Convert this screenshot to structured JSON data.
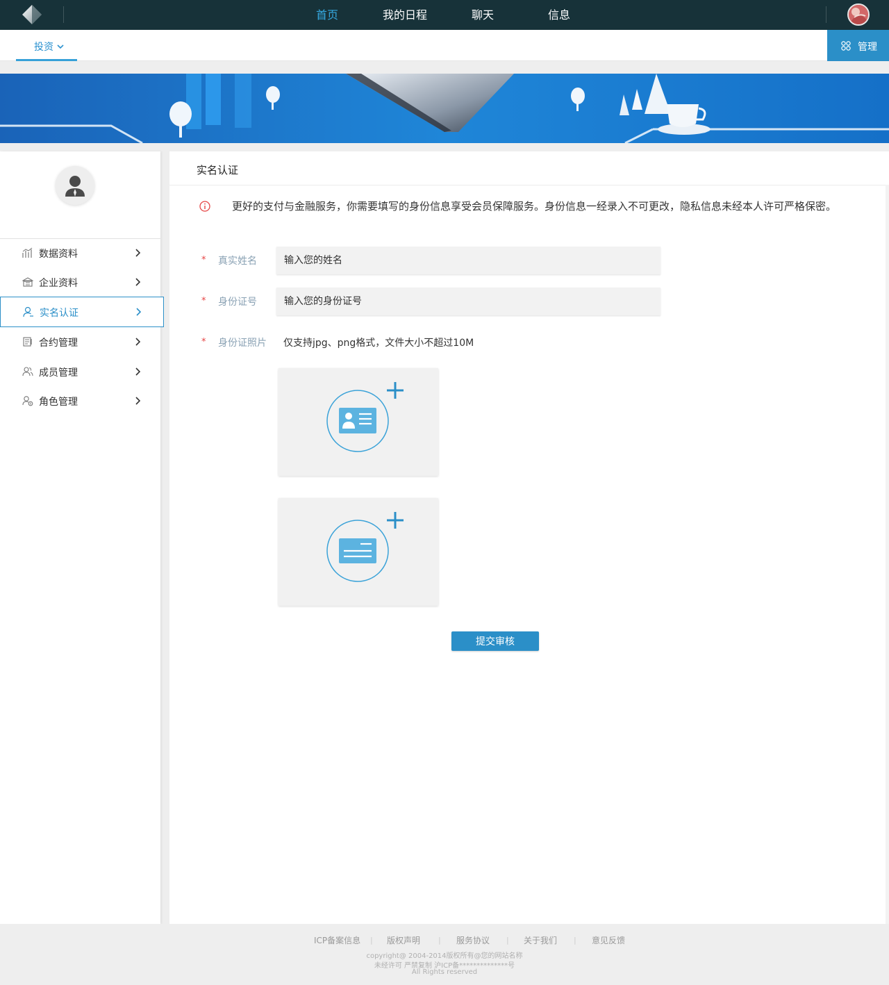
{
  "top_nav": {
    "items": [
      {
        "label": "首页",
        "active": true
      },
      {
        "label": "我的日程",
        "active": false
      },
      {
        "label": "聊天",
        "active": false
      },
      {
        "label": "信息",
        "active": false
      }
    ]
  },
  "sub_nav": {
    "tab_label": "投资",
    "manage_label": "管理"
  },
  "sidebar": {
    "items": [
      {
        "label": "数据资料",
        "icon": "chart-icon",
        "active": false
      },
      {
        "label": "企业资料",
        "icon": "building-icon",
        "active": false
      },
      {
        "label": "实名认证",
        "icon": "user-icon",
        "active": true
      },
      {
        "label": "合约管理",
        "icon": "contract-icon",
        "active": false
      },
      {
        "label": "成员管理",
        "icon": "members-icon",
        "active": false
      },
      {
        "label": "角色管理",
        "icon": "role-icon",
        "active": false
      }
    ]
  },
  "main": {
    "title": "实名认证",
    "notice": "更好的支付与金融服务，你需要填写的身份信息享受会员保障服务。身份信息一经录入不可更改，隐私信息未经本人许可严格保密。",
    "fields": {
      "name": {
        "label": "真实姓名",
        "placeholder": "输入您的姓名",
        "required": "*"
      },
      "id_number": {
        "label": "身份证号",
        "placeholder": "输入您的身份证号",
        "required": "*"
      },
      "id_photo": {
        "label": "身份证照片",
        "hint": "仅支持jpg、png格式，文件大小不超过10M",
        "required": "*"
      }
    },
    "submit_label": "提交审核"
  },
  "footer": {
    "links": [
      "ICP备案信息",
      "版权声明",
      "服务协议",
      "关于我们",
      "意见反馈"
    ],
    "separator": "|",
    "copyright": "copyright@ 2004-2014版权所有@您的网站名称",
    "license": "未经许可 严禁复制 沪ICP备**************号",
    "rights": "All Rights reserved"
  },
  "colors": {
    "topbar": "#173239",
    "accent": "#2b8fc8",
    "nav_active": "#36a9e1",
    "required": "#e64545"
  }
}
